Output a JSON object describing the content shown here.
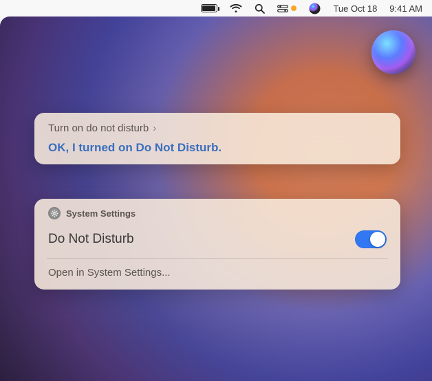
{
  "menubar": {
    "date": "Tue Oct 18",
    "time": "9:41 AM"
  },
  "siri": {
    "query": "Turn on do not disturb",
    "response": "OK, I turned on Do Not Disturb."
  },
  "settings_card": {
    "source": "System Settings",
    "title": "Do Not Disturb",
    "toggle_on": true,
    "open_label": "Open in System Settings..."
  }
}
